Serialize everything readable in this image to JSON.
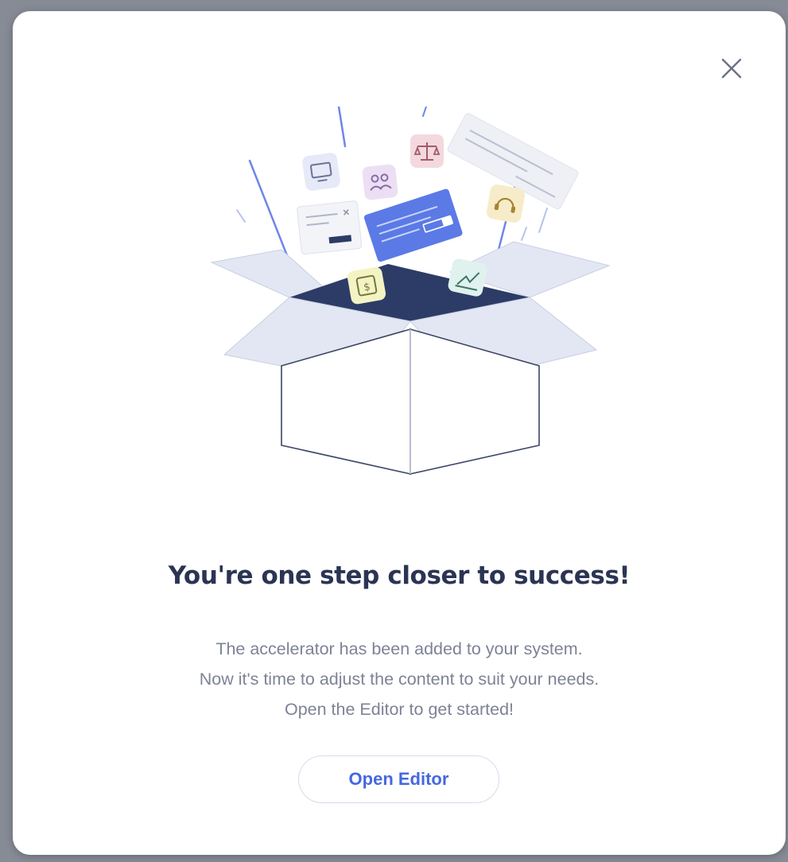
{
  "dialog": {
    "title": "You're one step closer to success!",
    "message_lines": [
      "The accelerator has been added to your system.",
      "Now it's time to adjust the content to suit your needs.",
      "Open the Editor to get started!"
    ],
    "primary_button_label": "Open Editor",
    "close_icon": "close-icon",
    "illustration": "open-box-illustration"
  },
  "colors": {
    "title": "#2b3453",
    "message": "#7d8396",
    "button_text": "#4667e0",
    "button_border": "#d8dcea",
    "box_interior": "#2c3c66",
    "box_flaps": "#e3e7f3",
    "card_accent": "#5b7ae6"
  }
}
